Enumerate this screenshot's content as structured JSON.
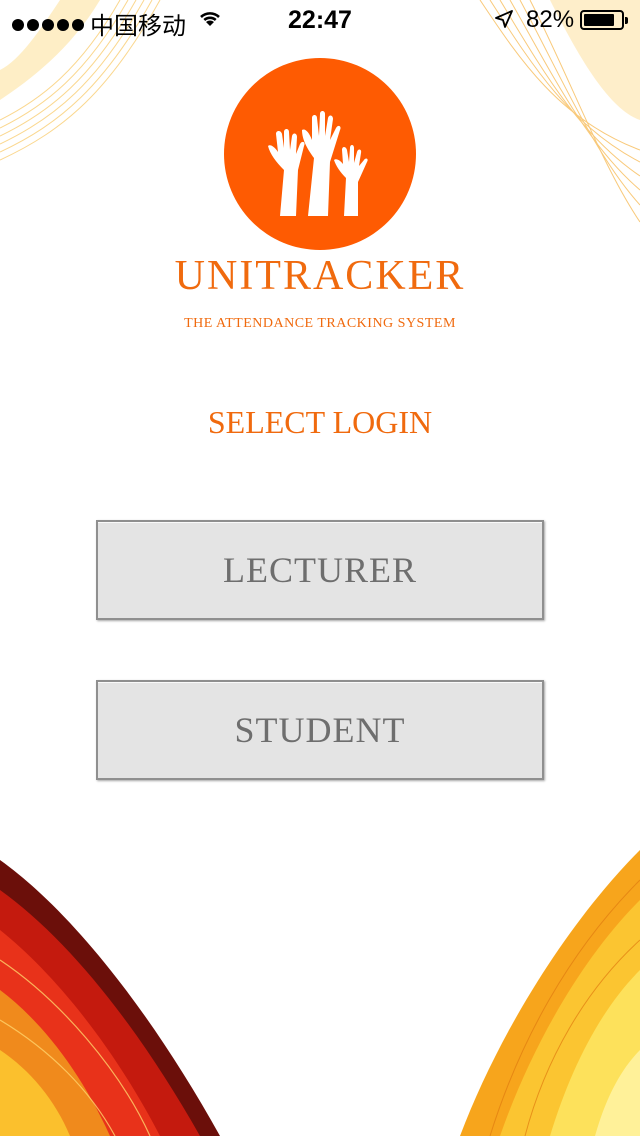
{
  "status_bar": {
    "carrier": "中国移动",
    "time": "22:47",
    "battery_percent": "82%",
    "battery_level": 0.82,
    "icons": [
      "signal-dots-icon",
      "wifi-icon",
      "location-arrow-icon",
      "battery-icon"
    ]
  },
  "app": {
    "brand": "UNITRACKER",
    "tagline": "THE ATTENDANCE TRACKING SYSTEM",
    "logo_icon": "raised-hands-icon"
  },
  "login": {
    "heading": "SELECT LOGIN",
    "lecturer_label": "LECTURER",
    "student_label": "STUDENT"
  },
  "colors": {
    "accent": "#fe5b02",
    "text_accent": "#f06a0e",
    "button_bg": "#e4e4e4",
    "button_text": "#6e6e6e"
  }
}
